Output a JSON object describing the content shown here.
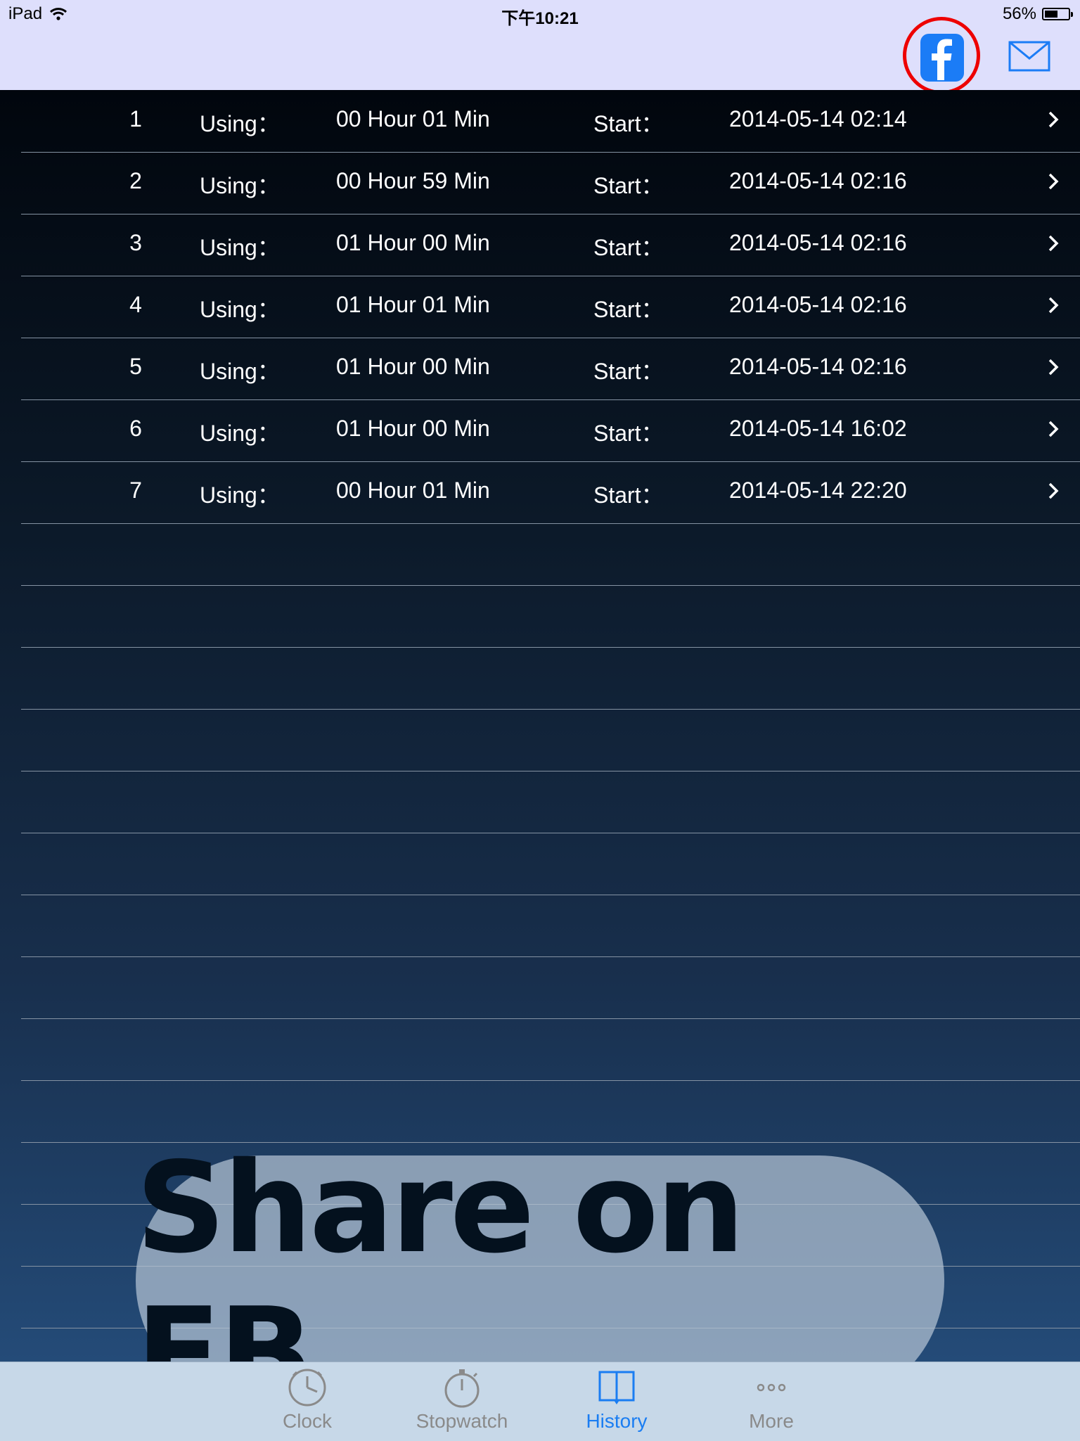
{
  "status_bar": {
    "device": "iPad",
    "time": "下午10:21",
    "battery_percent": "56%",
    "battery_level": 0.56
  },
  "nav": {
    "facebook_icon": "facebook-icon",
    "mail_icon": "mail-icon",
    "accent_color": "#1b7cf6",
    "highlight_color": "#ee0000"
  },
  "history": {
    "rows": [
      {
        "index": "1",
        "using_label": "Using：",
        "duration": "00 Hour 01 Min",
        "start_label": "Start：",
        "start": "2014-05-14 02:14"
      },
      {
        "index": "2",
        "using_label": "Using：",
        "duration": "00 Hour 59 Min",
        "start_label": "Start：",
        "start": "2014-05-14 02:16"
      },
      {
        "index": "3",
        "using_label": "Using：",
        "duration": "01 Hour 00 Min",
        "start_label": "Start：",
        "start": "2014-05-14 02:16"
      },
      {
        "index": "4",
        "using_label": "Using：",
        "duration": "01 Hour 01 Min",
        "start_label": "Start：",
        "start": "2014-05-14 02:16"
      },
      {
        "index": "5",
        "using_label": "Using：",
        "duration": "01 Hour 00 Min",
        "start_label": "Start：",
        "start": "2014-05-14 02:16"
      },
      {
        "index": "6",
        "using_label": "Using：",
        "duration": "01 Hour 00 Min",
        "start_label": "Start：",
        "start": "2014-05-14 16:02"
      },
      {
        "index": "7",
        "using_label": "Using：",
        "duration": "00 Hour 01 Min",
        "start_label": "Start：",
        "start": "2014-05-14 22:20"
      }
    ]
  },
  "overlay": {
    "share_text": "Share on FB"
  },
  "tab_bar": {
    "tabs": [
      {
        "label": "Clock",
        "icon": "clock-icon"
      },
      {
        "label": "Stopwatch",
        "icon": "stopwatch-icon"
      },
      {
        "label": "History",
        "icon": "book-icon",
        "active": true
      },
      {
        "label": "More",
        "icon": "more-icon"
      }
    ],
    "active_color": "#1a7df2",
    "inactive_color": "#8a8a8a"
  }
}
